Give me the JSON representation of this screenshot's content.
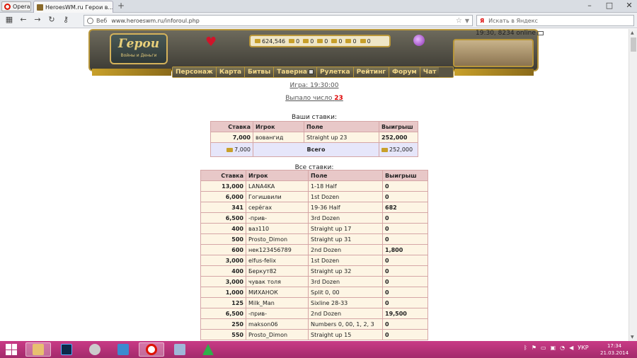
{
  "browser": {
    "menu_label": "Opera",
    "tab_title": "HeroesWM.ru Герои в...",
    "tab_close": "✕",
    "new_tab": "+",
    "address": {
      "label": "Веб",
      "url": "www.heroeswm.ru/inforoul.php"
    },
    "search_placeholder": "Искать в Яндекс",
    "search_logo": "Я"
  },
  "header": {
    "logo_text": "Герои",
    "logo_subtitle": "Войны и Деньги",
    "time_online": "19:30, 8234 online",
    "resources": [
      {
        "name": "gold",
        "value": "624,546"
      },
      {
        "name": "wood",
        "value": "0"
      },
      {
        "name": "ore",
        "value": "0"
      },
      {
        "name": "mercury",
        "value": "0"
      },
      {
        "name": "sulfur",
        "value": "0"
      },
      {
        "name": "crystals",
        "value": "0"
      },
      {
        "name": "gems",
        "value": "0"
      }
    ],
    "nav": [
      "Персонаж",
      "Карта",
      "Битвы",
      "Таверна",
      "Рулетка",
      "Рейтинг",
      "Форум",
      "Чат"
    ]
  },
  "game": {
    "game_link": "Игра: 19:30:00",
    "result_prefix": "Выпало число",
    "result_number": "23"
  },
  "your_bets": {
    "caption": "Ваши ставки:",
    "headers": [
      "Ставка",
      "Игрок",
      "Поле",
      "Выигрыш"
    ],
    "rows": [
      [
        "7,000",
        "вовангид",
        "Straight up 23",
        "252,000"
      ]
    ],
    "total": {
      "bet": "7,000",
      "label": "Всего",
      "win": "252,000"
    }
  },
  "all_bets": {
    "caption": "Все ставки:",
    "headers": [
      "Ставка",
      "Игрок",
      "Поле",
      "Выигрыш"
    ],
    "rows": [
      [
        "13,000",
        "LANA4KA",
        "1-18 Half",
        "0"
      ],
      [
        "6,000",
        "Гогишвили",
        "1st Dozen",
        "0"
      ],
      [
        "341",
        "серёгах",
        "19-36 Half",
        "682"
      ],
      [
        "6,500",
        "-прив-",
        "3rd Dozen",
        "0"
      ],
      [
        "400",
        "ваз110",
        "Straight up 17",
        "0"
      ],
      [
        "500",
        "Prosto_Dimon",
        "Straight up 31",
        "0"
      ],
      [
        "600",
        "нек123456789",
        "2nd Dozen",
        "1,800"
      ],
      [
        "3,000",
        "elfus-felix",
        "1st Dozen",
        "0"
      ],
      [
        "400",
        "Беркут82",
        "Straight up 32",
        "0"
      ],
      [
        "3,000",
        "чувак толя",
        "3rd Dozen",
        "0"
      ],
      [
        "1,000",
        "МИХАНОК",
        "Split 0, 00",
        "0"
      ],
      [
        "125",
        "Milk_Man",
        "Sixline 28-33",
        "0"
      ],
      [
        "6,500",
        "-прив-",
        "2nd Dozen",
        "19,500"
      ],
      [
        "250",
        "makson06",
        "Numbers 0, 00, 1, 2, 3",
        "0"
      ],
      [
        "550",
        "Prosto_Dimon",
        "Straight up 15",
        "0"
      ]
    ]
  },
  "taskbar": {
    "apps": [
      "explorer-icon",
      "photoshop-icon",
      "media-icon",
      "network-icon",
      "opera-icon",
      "photos-icon",
      "green-app-icon"
    ],
    "lang": "УКР",
    "time": "17:34",
    "date": "21.03.2014"
  }
}
